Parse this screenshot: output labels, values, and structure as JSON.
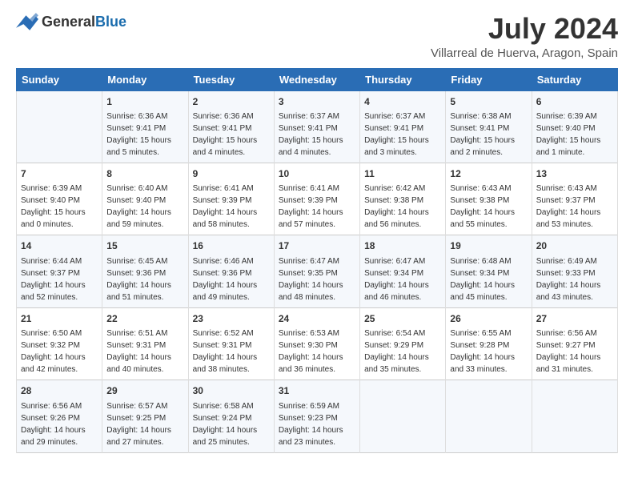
{
  "header": {
    "logo_general": "General",
    "logo_blue": "Blue",
    "title": "July 2024",
    "subtitle": "Villarreal de Huerva, Aragon, Spain"
  },
  "days_of_week": [
    "Sunday",
    "Monday",
    "Tuesday",
    "Wednesday",
    "Thursday",
    "Friday",
    "Saturday"
  ],
  "weeks": [
    [
      {
        "day": "",
        "content": ""
      },
      {
        "day": "1",
        "content": "Sunrise: 6:36 AM\nSunset: 9:41 PM\nDaylight: 15 hours\nand 5 minutes."
      },
      {
        "day": "2",
        "content": "Sunrise: 6:36 AM\nSunset: 9:41 PM\nDaylight: 15 hours\nand 4 minutes."
      },
      {
        "day": "3",
        "content": "Sunrise: 6:37 AM\nSunset: 9:41 PM\nDaylight: 15 hours\nand 4 minutes."
      },
      {
        "day": "4",
        "content": "Sunrise: 6:37 AM\nSunset: 9:41 PM\nDaylight: 15 hours\nand 3 minutes."
      },
      {
        "day": "5",
        "content": "Sunrise: 6:38 AM\nSunset: 9:41 PM\nDaylight: 15 hours\nand 2 minutes."
      },
      {
        "day": "6",
        "content": "Sunrise: 6:39 AM\nSunset: 9:40 PM\nDaylight: 15 hours\nand 1 minute."
      }
    ],
    [
      {
        "day": "7",
        "content": "Sunrise: 6:39 AM\nSunset: 9:40 PM\nDaylight: 15 hours\nand 0 minutes."
      },
      {
        "day": "8",
        "content": "Sunrise: 6:40 AM\nSunset: 9:40 PM\nDaylight: 14 hours\nand 59 minutes."
      },
      {
        "day": "9",
        "content": "Sunrise: 6:41 AM\nSunset: 9:39 PM\nDaylight: 14 hours\nand 58 minutes."
      },
      {
        "day": "10",
        "content": "Sunrise: 6:41 AM\nSunset: 9:39 PM\nDaylight: 14 hours\nand 57 minutes."
      },
      {
        "day": "11",
        "content": "Sunrise: 6:42 AM\nSunset: 9:38 PM\nDaylight: 14 hours\nand 56 minutes."
      },
      {
        "day": "12",
        "content": "Sunrise: 6:43 AM\nSunset: 9:38 PM\nDaylight: 14 hours\nand 55 minutes."
      },
      {
        "day": "13",
        "content": "Sunrise: 6:43 AM\nSunset: 9:37 PM\nDaylight: 14 hours\nand 53 minutes."
      }
    ],
    [
      {
        "day": "14",
        "content": "Sunrise: 6:44 AM\nSunset: 9:37 PM\nDaylight: 14 hours\nand 52 minutes."
      },
      {
        "day": "15",
        "content": "Sunrise: 6:45 AM\nSunset: 9:36 PM\nDaylight: 14 hours\nand 51 minutes."
      },
      {
        "day": "16",
        "content": "Sunrise: 6:46 AM\nSunset: 9:36 PM\nDaylight: 14 hours\nand 49 minutes."
      },
      {
        "day": "17",
        "content": "Sunrise: 6:47 AM\nSunset: 9:35 PM\nDaylight: 14 hours\nand 48 minutes."
      },
      {
        "day": "18",
        "content": "Sunrise: 6:47 AM\nSunset: 9:34 PM\nDaylight: 14 hours\nand 46 minutes."
      },
      {
        "day": "19",
        "content": "Sunrise: 6:48 AM\nSunset: 9:34 PM\nDaylight: 14 hours\nand 45 minutes."
      },
      {
        "day": "20",
        "content": "Sunrise: 6:49 AM\nSunset: 9:33 PM\nDaylight: 14 hours\nand 43 minutes."
      }
    ],
    [
      {
        "day": "21",
        "content": "Sunrise: 6:50 AM\nSunset: 9:32 PM\nDaylight: 14 hours\nand 42 minutes."
      },
      {
        "day": "22",
        "content": "Sunrise: 6:51 AM\nSunset: 9:31 PM\nDaylight: 14 hours\nand 40 minutes."
      },
      {
        "day": "23",
        "content": "Sunrise: 6:52 AM\nSunset: 9:31 PM\nDaylight: 14 hours\nand 38 minutes."
      },
      {
        "day": "24",
        "content": "Sunrise: 6:53 AM\nSunset: 9:30 PM\nDaylight: 14 hours\nand 36 minutes."
      },
      {
        "day": "25",
        "content": "Sunrise: 6:54 AM\nSunset: 9:29 PM\nDaylight: 14 hours\nand 35 minutes."
      },
      {
        "day": "26",
        "content": "Sunrise: 6:55 AM\nSunset: 9:28 PM\nDaylight: 14 hours\nand 33 minutes."
      },
      {
        "day": "27",
        "content": "Sunrise: 6:56 AM\nSunset: 9:27 PM\nDaylight: 14 hours\nand 31 minutes."
      }
    ],
    [
      {
        "day": "28",
        "content": "Sunrise: 6:56 AM\nSunset: 9:26 PM\nDaylight: 14 hours\nand 29 minutes."
      },
      {
        "day": "29",
        "content": "Sunrise: 6:57 AM\nSunset: 9:25 PM\nDaylight: 14 hours\nand 27 minutes."
      },
      {
        "day": "30",
        "content": "Sunrise: 6:58 AM\nSunset: 9:24 PM\nDaylight: 14 hours\nand 25 minutes."
      },
      {
        "day": "31",
        "content": "Sunrise: 6:59 AM\nSunset: 9:23 PM\nDaylight: 14 hours\nand 23 minutes."
      },
      {
        "day": "",
        "content": ""
      },
      {
        "day": "",
        "content": ""
      },
      {
        "day": "",
        "content": ""
      }
    ]
  ]
}
